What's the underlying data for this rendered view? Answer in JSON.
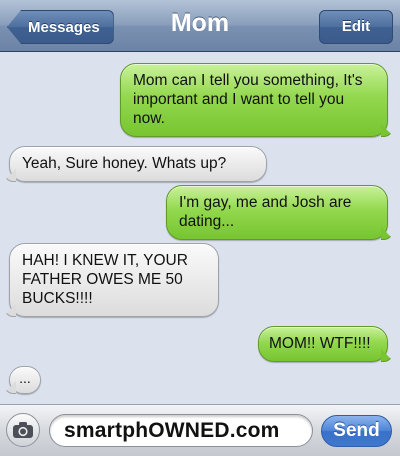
{
  "header": {
    "title": "Mom",
    "back_label": "Messages",
    "edit_label": "Edit"
  },
  "messages": [
    {
      "direction": "sent",
      "text": "Mom can I tell you something, It's important and I want to tell you now."
    },
    {
      "direction": "received",
      "text": "Yeah, Sure honey. Whats up?"
    },
    {
      "direction": "sent",
      "text": "I'm gay, me and Josh are dating..."
    },
    {
      "direction": "received",
      "text": "HAH! I KNEW IT, YOUR FATHER OWES ME 50 BUCKS!!!!"
    },
    {
      "direction": "sent",
      "text": "MOM!! WTF!!!!"
    },
    {
      "direction": "received",
      "text": "..."
    }
  ],
  "input": {
    "value": "smartphOWNED.com",
    "send_label": "Send"
  },
  "colors": {
    "sent_bubble": "#93d84e",
    "received_bubble": "#e8e8e8",
    "background": "#dbe2ed",
    "send_button": "#4d83d6"
  }
}
